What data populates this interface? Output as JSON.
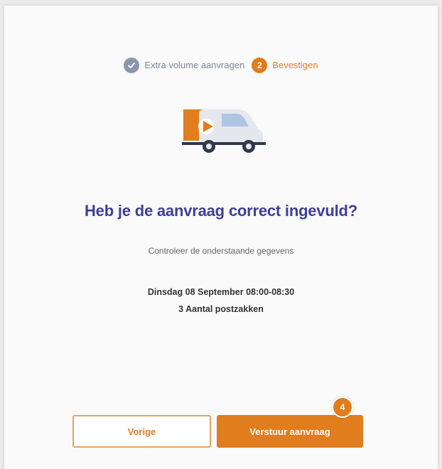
{
  "stepper": {
    "steps": [
      {
        "label": "Extra volume aanvragen",
        "state": "done",
        "icon": "check-icon"
      },
      {
        "label": "Bevestigen",
        "state": "active",
        "number": "2"
      }
    ]
  },
  "illustration": {
    "icon": "delivery-van-icon"
  },
  "main": {
    "title": "Heb je de aanvraag correct ingevuld?",
    "subtitle": "Controleer de onderstaande gegevens",
    "details": [
      "Dinsdag 08 September 08:00-08:30",
      "3 Aantal postzakken"
    ]
  },
  "actions": {
    "prev_label": "Vorige",
    "submit_label": "Verstuur aanvraag",
    "badge": "4"
  },
  "colors": {
    "accent": "#e07d1d",
    "title": "#3f3f96",
    "done": "#8a96ab"
  }
}
